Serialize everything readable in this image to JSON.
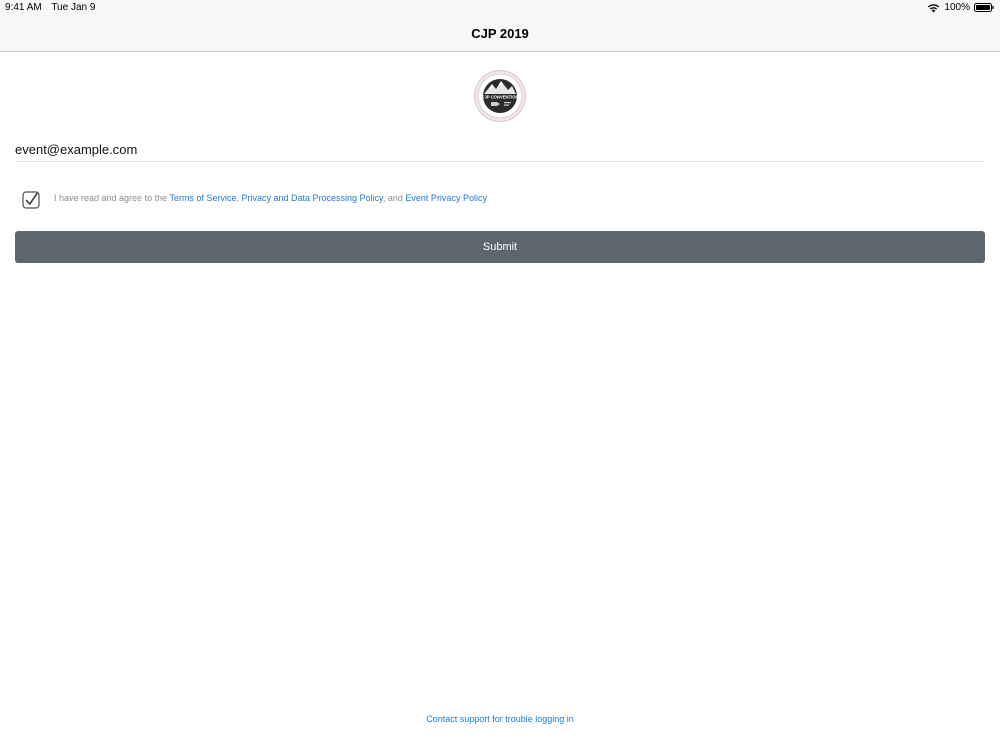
{
  "status_bar": {
    "time": "9:41 AM",
    "date": "Tue Jan 9",
    "battery": "100%"
  },
  "nav": {
    "title": "CJP 2019"
  },
  "logo": {
    "text": "CJP CONVENTION"
  },
  "form": {
    "email_value": "event@example.com"
  },
  "agreement": {
    "prefix": "I have read and agree to the ",
    "terms_link": "Terms of Service",
    "comma": ", ",
    "privacy_link": "Privacy and Data Processing Policy",
    "and_text": ", and ",
    "event_privacy_link": "Event Privacy Policy",
    "checked": true
  },
  "submit_label": "Submit",
  "support_link": "Contact support for trouble logging in",
  "colors": {
    "link": "#1c7bd6",
    "button": "#5c666d",
    "bar": "#f7f7f7"
  },
  "icons": [
    "wifi-icon",
    "battery-icon",
    "checkbox-checked-icon"
  ]
}
